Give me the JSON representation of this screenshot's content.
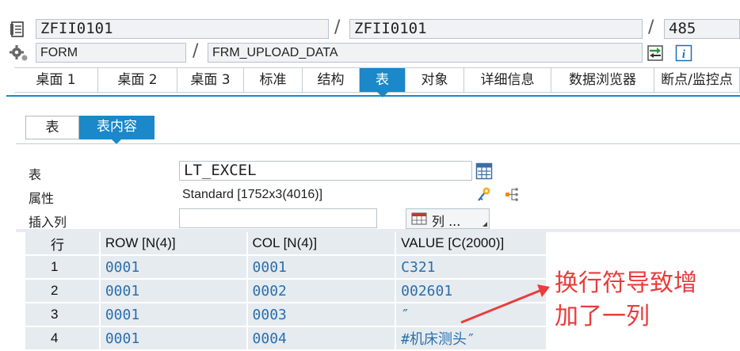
{
  "header": {
    "row1": {
      "field1": "ZFII0101",
      "field2": "ZFII0101",
      "field3": "485"
    },
    "row2": {
      "field1": "FORM",
      "field2": "FRM_UPLOAD_DATA"
    },
    "separator": "/"
  },
  "tabs": [
    "桌面 1",
    "桌面 2",
    "桌面 3",
    "标准",
    "结构",
    "表",
    "对象",
    "详细信息",
    "数据浏览器",
    "断点/监控点"
  ],
  "active_tab": "表",
  "subtabs": [
    "表",
    "表内容"
  ],
  "active_subtab": "表内容",
  "form": {
    "table_label": "表",
    "table_value": "LT_EXCEL",
    "attr_label": "属性",
    "attr_value": "Standard [1752x3(4016)]",
    "insert_label": "插入列",
    "insert_value": "",
    "column_button_label": "列 ..."
  },
  "grid": {
    "headers": [
      "行",
      "ROW [N(4)]",
      "COL [N(4)]",
      "VALUE [C(2000)]"
    ],
    "rows": [
      [
        "1",
        "0001",
        "0001",
        "C321"
      ],
      [
        "2",
        "0001",
        "0002",
        "002601"
      ],
      [
        "3",
        "0001",
        "0003",
        "″"
      ],
      [
        "4",
        "0001",
        "0004",
        "#机床测头″"
      ]
    ]
  },
  "annotation": {
    "line1": "换行符导致增",
    "line2": "加了一列",
    "color": "#ea3c3c"
  },
  "colors": {
    "accent": "#1a88c9",
    "grid_bg": "#e6ebf0",
    "value_text": "#2a6fad"
  }
}
